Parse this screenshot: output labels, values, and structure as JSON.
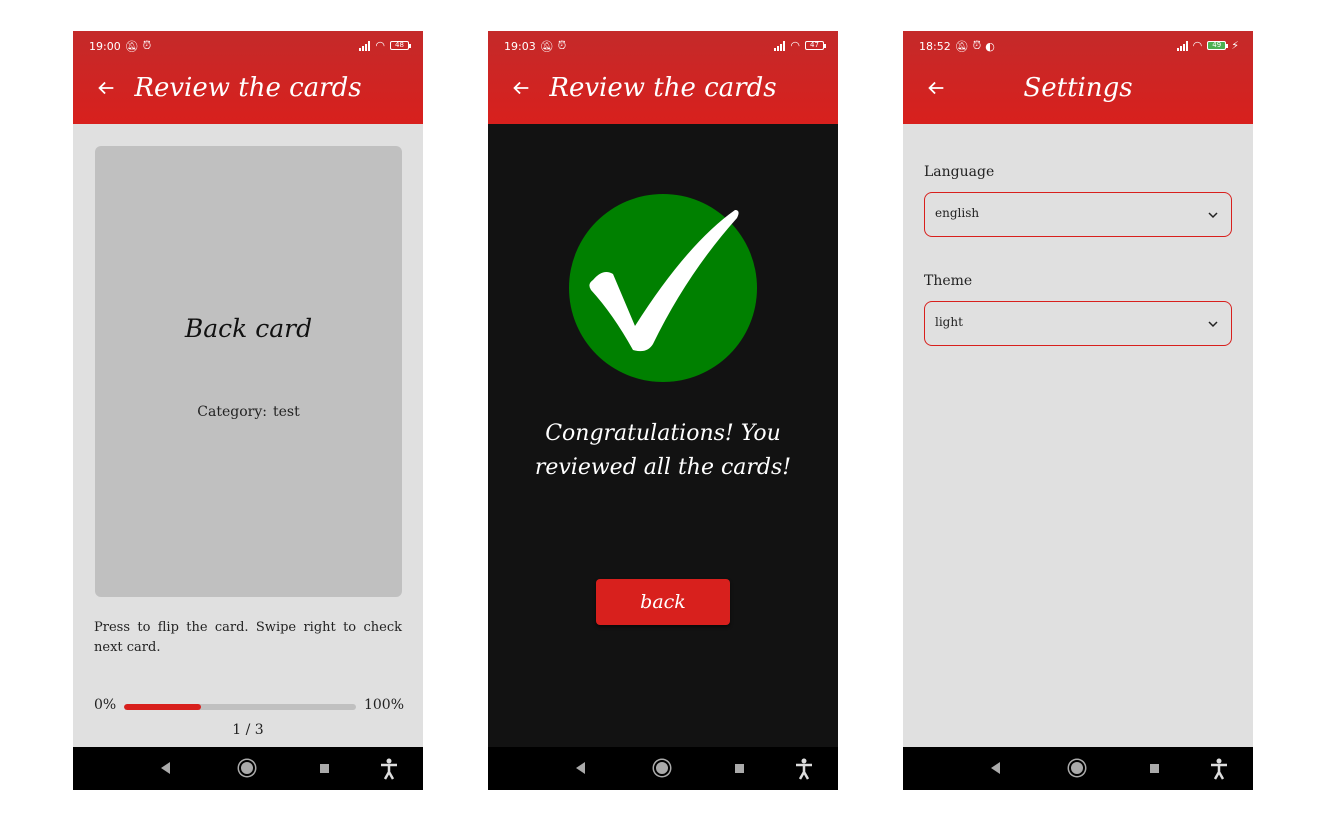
{
  "colors": {
    "accent": "#d8201d",
    "header": "#c42a2a",
    "success": "#008000",
    "dark_bg": "#121212",
    "light_bg": "#e0e0e0"
  },
  "screen1": {
    "status_time": "19:00",
    "battery": "48",
    "title": "Review the cards",
    "card_title": "Back card",
    "category_label": "Category:",
    "category_value": "test",
    "hint": "Press to flip the card. Swipe right to check next card.",
    "progress_min": "0%",
    "progress_max": "100%",
    "progress_fraction": 0.333,
    "counter": "1 / 3"
  },
  "screen2": {
    "status_time": "19:03",
    "battery": "47",
    "title": "Review the cards",
    "message": "Congratulations! You reviewed all the cards!",
    "back_label": "back",
    "icon": "check-circle-icon"
  },
  "screen3": {
    "status_time": "18:52",
    "battery": "49",
    "title": "Settings",
    "language_label": "Language",
    "language_value": "english",
    "theme_label": "Theme",
    "theme_value": "light"
  }
}
